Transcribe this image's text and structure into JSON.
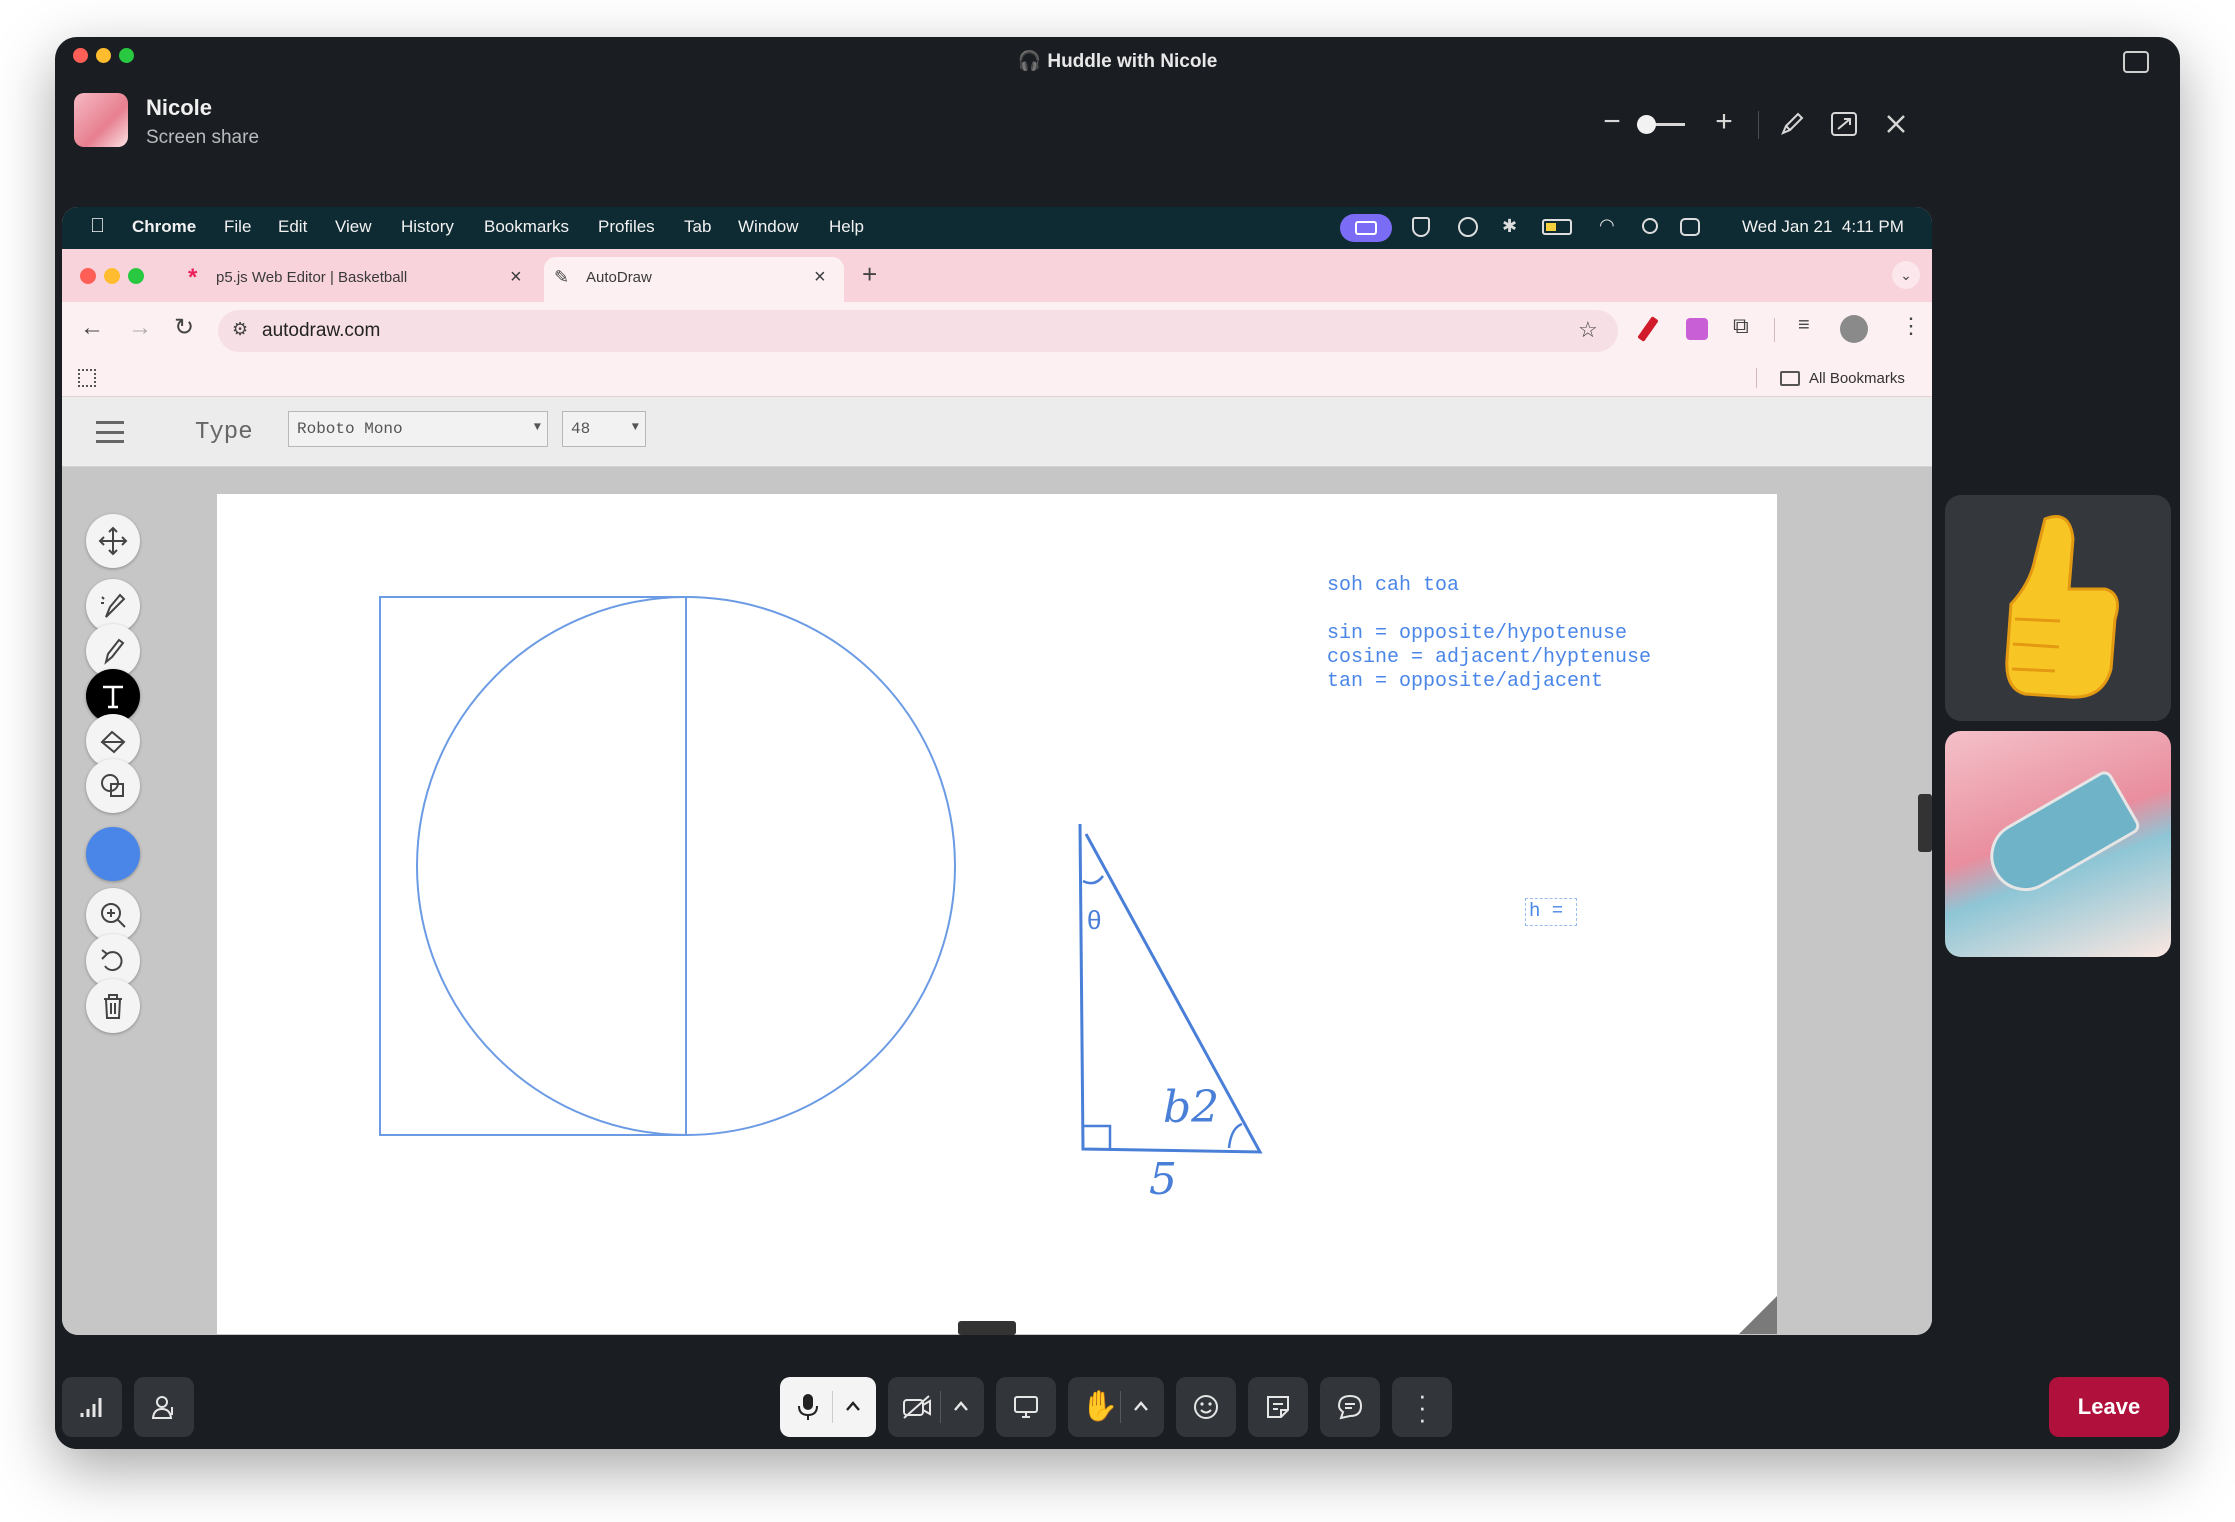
{
  "huddle": {
    "title": "Huddle with Nicole",
    "presenter_name": "Nicole",
    "presenter_status": "Screen share",
    "leave_label": "Leave"
  },
  "mac_menubar": {
    "app": "Chrome",
    "items": [
      "File",
      "Edit",
      "View",
      "History",
      "Bookmarks",
      "Profiles",
      "Tab",
      "Window",
      "Help"
    ],
    "datetime": "Wed Jan 21  4:11 PM"
  },
  "browser": {
    "tabs": [
      {
        "title": "p5.js Web Editor | Basketball",
        "active": false
      },
      {
        "title": "AutoDraw",
        "active": true
      }
    ],
    "url": "autodraw.com",
    "bookmarks_label": "All Bookmarks"
  },
  "autodraw": {
    "mode_label": "Type",
    "font": "Roboto Mono",
    "size": "48",
    "text_lines": [
      "soh cah toa",
      "",
      "sin = opposite/hypotenuse",
      "cosine = adjacent/hyptenuse",
      "tan = opposite/adjacent"
    ],
    "input_text": "h =",
    "handwriting_b2": "b2",
    "handwriting_5": "5",
    "handwriting_theta": "θ",
    "active_color": "#4a86e8"
  },
  "colors": {
    "window_bg": "#1a1d21",
    "chrome_tab": "#f8d3dc",
    "leave": "#b0113c",
    "ink": "#4a86e8"
  }
}
